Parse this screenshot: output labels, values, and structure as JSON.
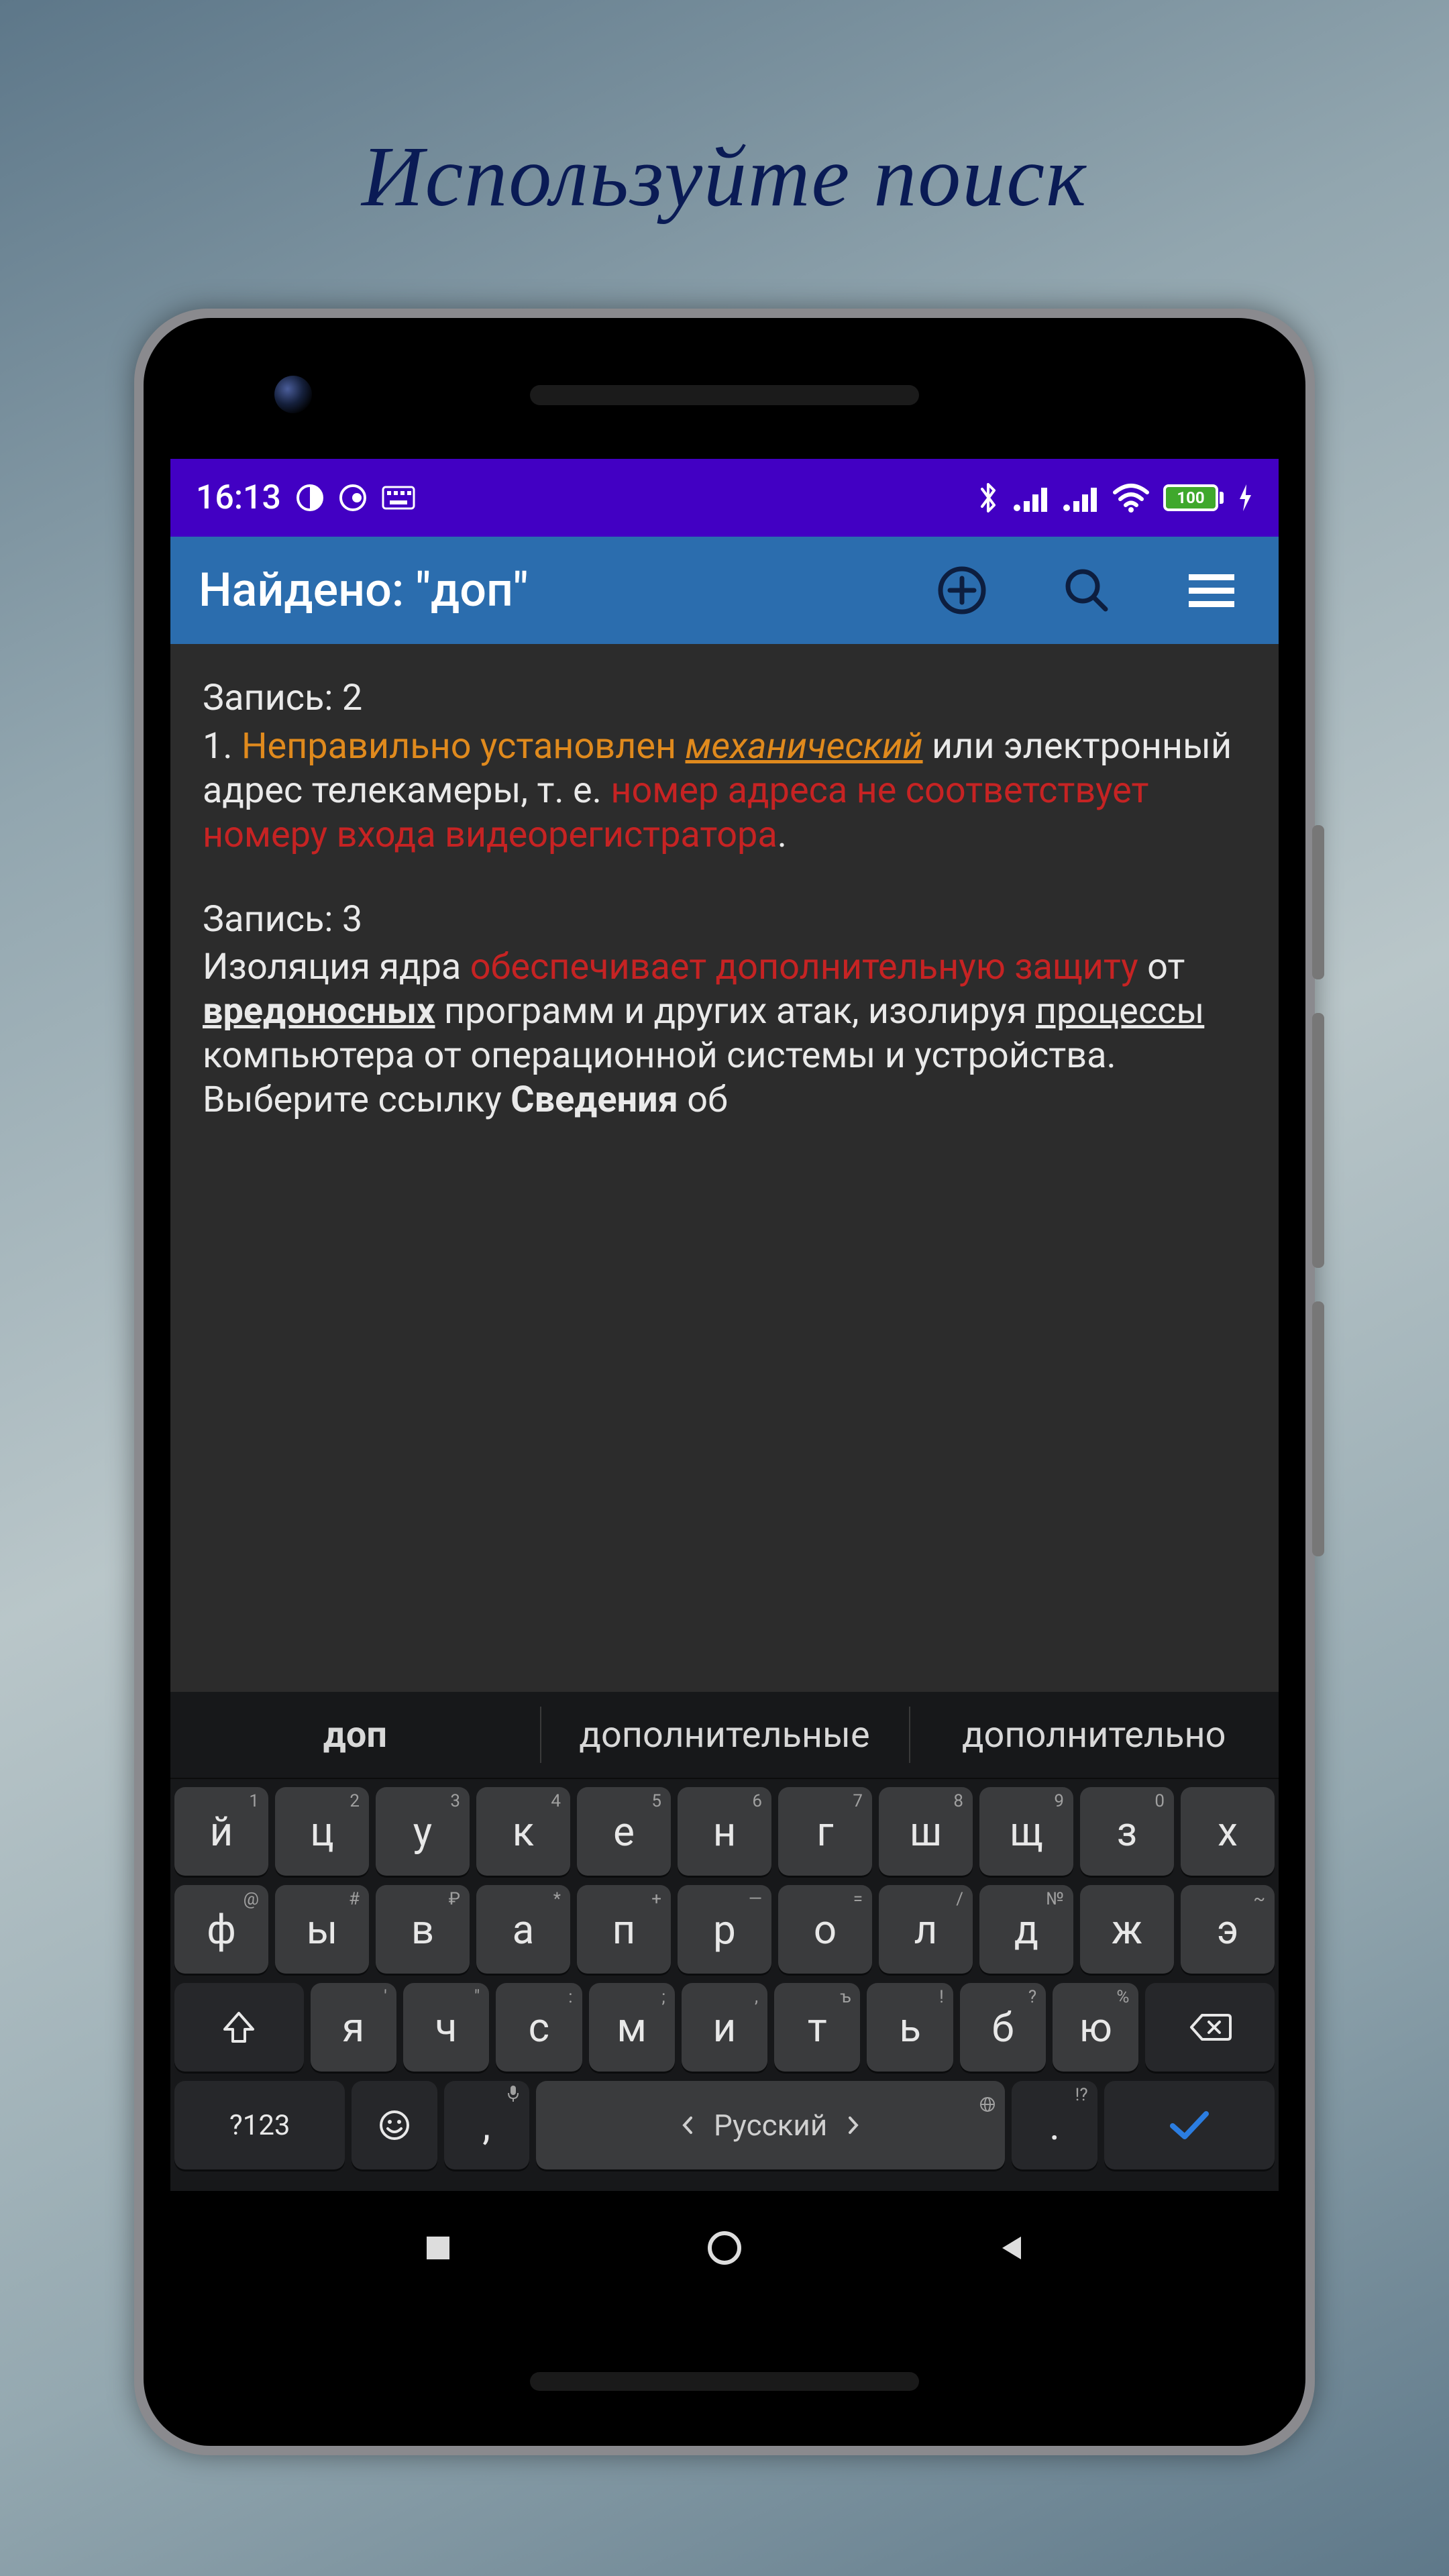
{
  "promo_title": "Используйте поиск",
  "status": {
    "time": "16:13",
    "battery": "100"
  },
  "appbar": {
    "title": "Найдено: \"доп\""
  },
  "records": [
    {
      "header": "Запись: 2",
      "num": "1. ",
      "t1_orange": "Неправильно установлен ",
      "t1_orange_u": "механический",
      "t2": " или электронный адрес телекамеры, т. е. ",
      "t3_red": "номер адреса не соответствует номеру входа видеорегистратора",
      "t4": "."
    },
    {
      "header": "Запись: 3",
      "a": "Изоляция ядра ",
      "b_red": "обеспечивает дополнительную защиту",
      "c": " от ",
      "d_bu": "вредоносных",
      "e": " программ и других атак, изолируя ",
      "f_u": "процессы",
      "g": " компьютера от операционной системы и устройства. Выберите ссылку ",
      "h_b": "Сведения",
      "i": " об"
    }
  ],
  "suggestions": [
    "доп",
    "дополнительные",
    "дополнительно"
  ],
  "keyboard": {
    "row1": [
      {
        "k": "й",
        "h": "1"
      },
      {
        "k": "ц",
        "h": "2"
      },
      {
        "k": "у",
        "h": "3"
      },
      {
        "k": "к",
        "h": "4"
      },
      {
        "k": "е",
        "h": "5"
      },
      {
        "k": "н",
        "h": "6"
      },
      {
        "k": "г",
        "h": "7"
      },
      {
        "k": "ш",
        "h": "8"
      },
      {
        "k": "щ",
        "h": "9"
      },
      {
        "k": "з",
        "h": "0"
      },
      {
        "k": "х",
        "h": ""
      }
    ],
    "row2": [
      {
        "k": "ф",
        "h": "@"
      },
      {
        "k": "ы",
        "h": "#"
      },
      {
        "k": "в",
        "h": "₽"
      },
      {
        "k": "а",
        "h": "*"
      },
      {
        "k": "п",
        "h": "+"
      },
      {
        "k": "р",
        "h": "—"
      },
      {
        "k": "о",
        "h": "="
      },
      {
        "k": "л",
        "h": "/"
      },
      {
        "k": "д",
        "h": "№"
      },
      {
        "k": "ж",
        "h": ""
      },
      {
        "k": "э",
        "h": "~"
      }
    ],
    "row3": [
      {
        "k": "я",
        "h": "'"
      },
      {
        "k": "ч",
        "h": "\""
      },
      {
        "k": "с",
        "h": ":"
      },
      {
        "k": "м",
        "h": ";"
      },
      {
        "k": "и",
        "h": ","
      },
      {
        "k": "т",
        "h": "ъ"
      },
      {
        "k": "ь",
        "h": "!"
      },
      {
        "k": "б",
        "h": "?"
      },
      {
        "k": "ю",
        "h": "%"
      }
    ],
    "symnum": "?123",
    "comma": ",",
    "space_lang": "Русский",
    "period": ".",
    "period_hint": "!?",
    "comma_hint": "🎤"
  }
}
